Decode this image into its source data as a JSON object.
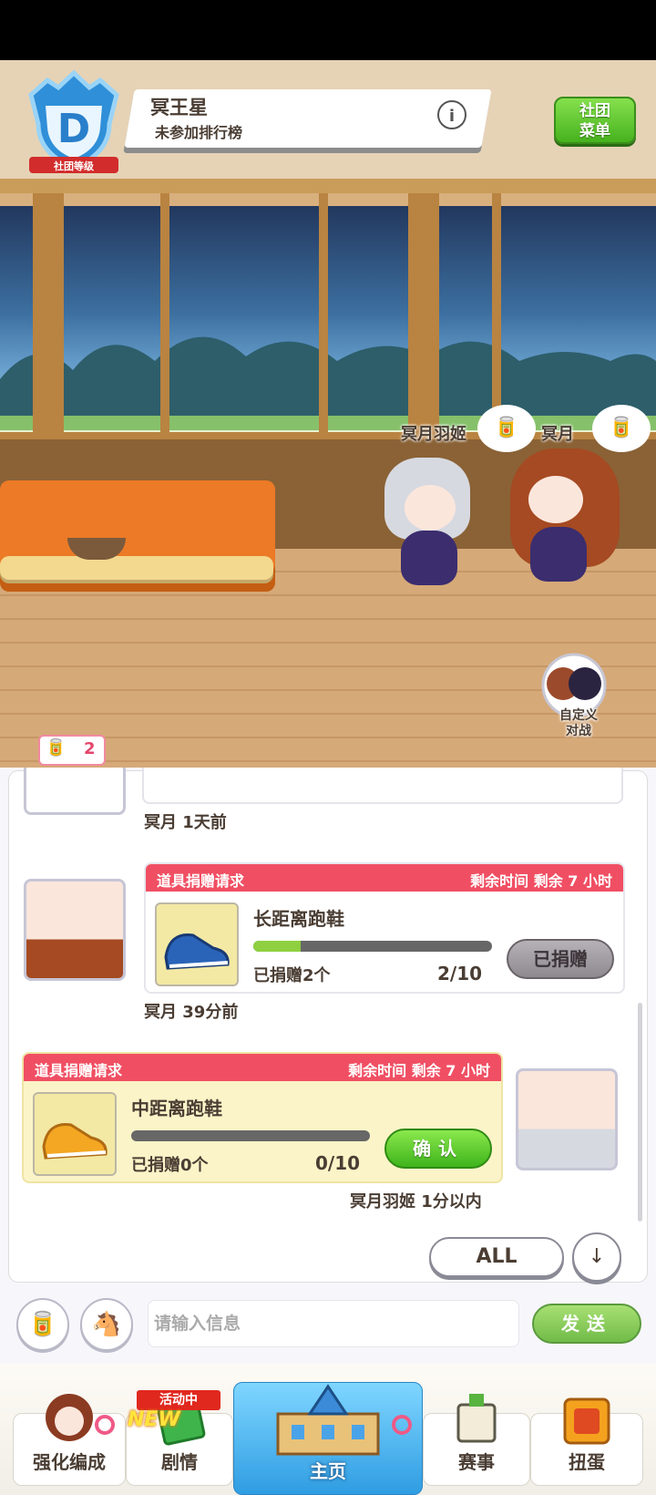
{
  "header": {
    "rank_letter": "D",
    "rank_ribbon": "社团等级",
    "club_name": "冥王星",
    "club_ranking": "未参加排行榜",
    "info_icon": "i",
    "menu_button": [
      "社团",
      "菜单"
    ]
  },
  "scene": {
    "characters": [
      {
        "name": "冥月羽姬",
        "bubble_icon": "item-can-icon"
      },
      {
        "name": "冥月",
        "bubble_icon": "item-can-icon"
      }
    ],
    "battle_button": [
      "自定义",
      "对战"
    ]
  },
  "notification": {
    "count": "2"
  },
  "chat": {
    "messages": [
      {
        "sender_meta": "冥月 1天前"
      },
      {
        "side": "left",
        "header": "道具捐赠请求",
        "time_left": "剩余时间 剩余 7 小时",
        "item_name": "长距离跑鞋",
        "donated_text": "已捐赠2个",
        "ratio": "2/10",
        "progress": 0.2,
        "button": "已捐赠",
        "meta": "冥月 39分前"
      },
      {
        "side": "right",
        "header": "道具捐赠请求",
        "time_left": "剩余时间 剩余 7 小时",
        "item_name": "中距离跑鞋",
        "donated_text": "已捐赠0个",
        "ratio": "0/10",
        "progress": 0,
        "button": "确认",
        "meta": "冥月羽姬 1分以内"
      }
    ],
    "filter_button": "ALL",
    "scroll_down_icon": "↓"
  },
  "input_bar": {
    "placeholder": "请输入信息",
    "send_button": "发送"
  },
  "nav": {
    "event_tag": "活动中",
    "new_tag": "NEW",
    "tabs": [
      {
        "label": "强化编成"
      },
      {
        "label": "剧情"
      },
      {
        "label": "主页"
      },
      {
        "label": "赛事"
      },
      {
        "label": "扭蛋"
      }
    ]
  },
  "colors": {
    "accent_red": "#f04f63",
    "accent_green": "#46b21e",
    "text_brown": "#4a3d33",
    "home_blue": "#2f9de2"
  }
}
